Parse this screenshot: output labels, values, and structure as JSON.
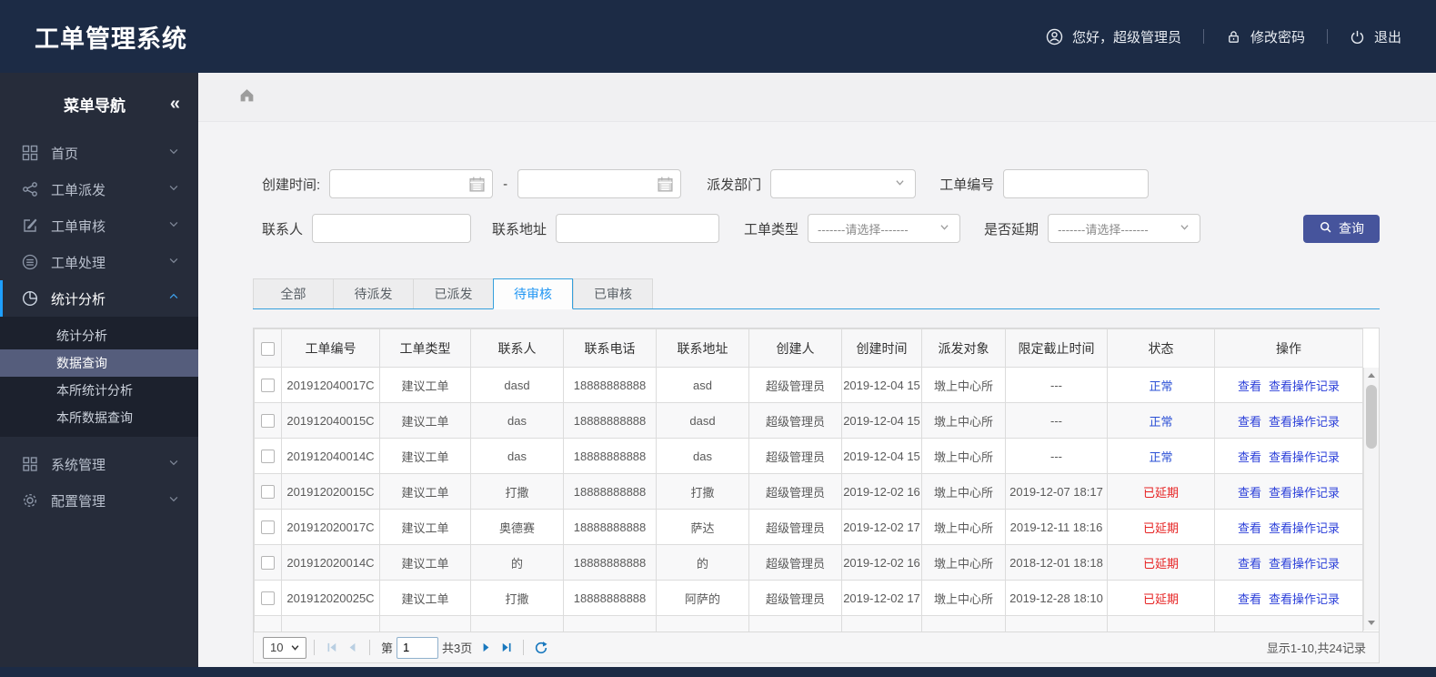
{
  "colors": {
    "header_bg": "#1c2b45",
    "sidebar_bg": "#262c3a",
    "sidebar_active_accent": "#1e9fff",
    "selected_submenu_bg": "#555d7c",
    "query_button_bg": "#46549c",
    "tab_active_blue": "#2196f3",
    "link_blue": "#2b3fd9",
    "status_normal_blue": "#2b50d5",
    "status_delayed_red": "#e62222"
  },
  "header": {
    "title": "工单管理系统",
    "greeting": "您好，超级管理员",
    "change_password": "修改密码",
    "logout": "退出"
  },
  "sidebar": {
    "title": "菜单导航",
    "collapse_glyph": "«",
    "items": [
      {
        "label": "首页",
        "icon": "grid-icon"
      },
      {
        "label": "工单派发",
        "icon": "share-icon"
      },
      {
        "label": "工单审核",
        "icon": "edit-icon"
      },
      {
        "label": "工单处理",
        "icon": "database-icon"
      },
      {
        "label": "统计分析",
        "icon": "pie-chart-icon",
        "active": true,
        "children": [
          {
            "label": "统计分析"
          },
          {
            "label": "数据查询",
            "selected": true
          },
          {
            "label": "本所统计分析"
          },
          {
            "label": "本所数据查询"
          }
        ]
      },
      {
        "label": "系统管理",
        "icon": "apps-icon"
      },
      {
        "label": "配置管理",
        "icon": "gear-icon"
      }
    ]
  },
  "filters": {
    "create_time_label": "创建时间:",
    "date_separator": "-",
    "dispatch_dept_label": "派发部门",
    "order_no_label": "工单编号",
    "contact_label": "联系人",
    "address_label": "联系地址",
    "order_type_label": "工单类型",
    "order_type_placeholder": "-------请选择-------",
    "delay_label": "是否延期",
    "delay_placeholder": "-------请选择-------",
    "search_button": "查询"
  },
  "tabs": [
    {
      "label": "全部"
    },
    {
      "label": "待派发"
    },
    {
      "label": "已派发"
    },
    {
      "label": "待审核",
      "active": true
    },
    {
      "label": "已审核"
    }
  ],
  "table": {
    "columns": [
      "工单编号",
      "工单类型",
      "联系人",
      "联系电话",
      "联系地址",
      "创建人",
      "创建时间",
      "派发对象",
      "限定截止时间",
      "状态",
      "操作"
    ],
    "view_label": "查看",
    "view_log_label": "查看操作记录",
    "rows": [
      {
        "order_no": "201912040017C",
        "type": "建议工单",
        "contact": "dasd",
        "phone": "18888888888",
        "address": "asd",
        "creator": "超级管理员",
        "created": "2019-12-04 15",
        "target": "墩上中心所",
        "deadline": "---",
        "status": "正常",
        "status_color": "blue"
      },
      {
        "order_no": "201912040015C",
        "type": "建议工单",
        "contact": "das",
        "phone": "18888888888",
        "address": "dasd",
        "creator": "超级管理员",
        "created": "2019-12-04 15",
        "target": "墩上中心所",
        "deadline": "---",
        "status": "正常",
        "status_color": "blue"
      },
      {
        "order_no": "201912040014C",
        "type": "建议工单",
        "contact": "das",
        "phone": "18888888888",
        "address": "das",
        "creator": "超级管理员",
        "created": "2019-12-04 15",
        "target": "墩上中心所",
        "deadline": "---",
        "status": "正常",
        "status_color": "blue"
      },
      {
        "order_no": "201912020015C",
        "type": "建议工单",
        "contact": "打撒",
        "phone": "18888888888",
        "address": "打撒",
        "creator": "超级管理员",
        "created": "2019-12-02 16",
        "target": "墩上中心所",
        "deadline": "2019-12-07 18:17",
        "status": "已延期",
        "status_color": "red"
      },
      {
        "order_no": "201912020017C",
        "type": "建议工单",
        "contact": "奥德赛",
        "phone": "18888888888",
        "address": "萨达",
        "creator": "超级管理员",
        "created": "2019-12-02 17",
        "target": "墩上中心所",
        "deadline": "2019-12-11 18:16",
        "status": "已延期",
        "status_color": "red"
      },
      {
        "order_no": "201912020014C",
        "type": "建议工单",
        "contact": "的",
        "phone": "18888888888",
        "address": "的",
        "creator": "超级管理员",
        "created": "2019-12-02 16",
        "target": "墩上中心所",
        "deadline": "2018-12-01 18:18",
        "status": "已延期",
        "status_color": "red"
      },
      {
        "order_no": "201912020025C",
        "type": "建议工单",
        "contact": "打撒",
        "phone": "18888888888",
        "address": "阿萨的",
        "creator": "超级管理员",
        "created": "2019-12-02 17",
        "target": "墩上中心所",
        "deadline": "2019-12-28 18:10",
        "status": "已延期",
        "status_color": "red"
      }
    ]
  },
  "pagination": {
    "page_size": "10",
    "page_prefix": "第",
    "current_page": "1",
    "total_pages": "共3页",
    "summary": "显示1-10,共24记录"
  }
}
